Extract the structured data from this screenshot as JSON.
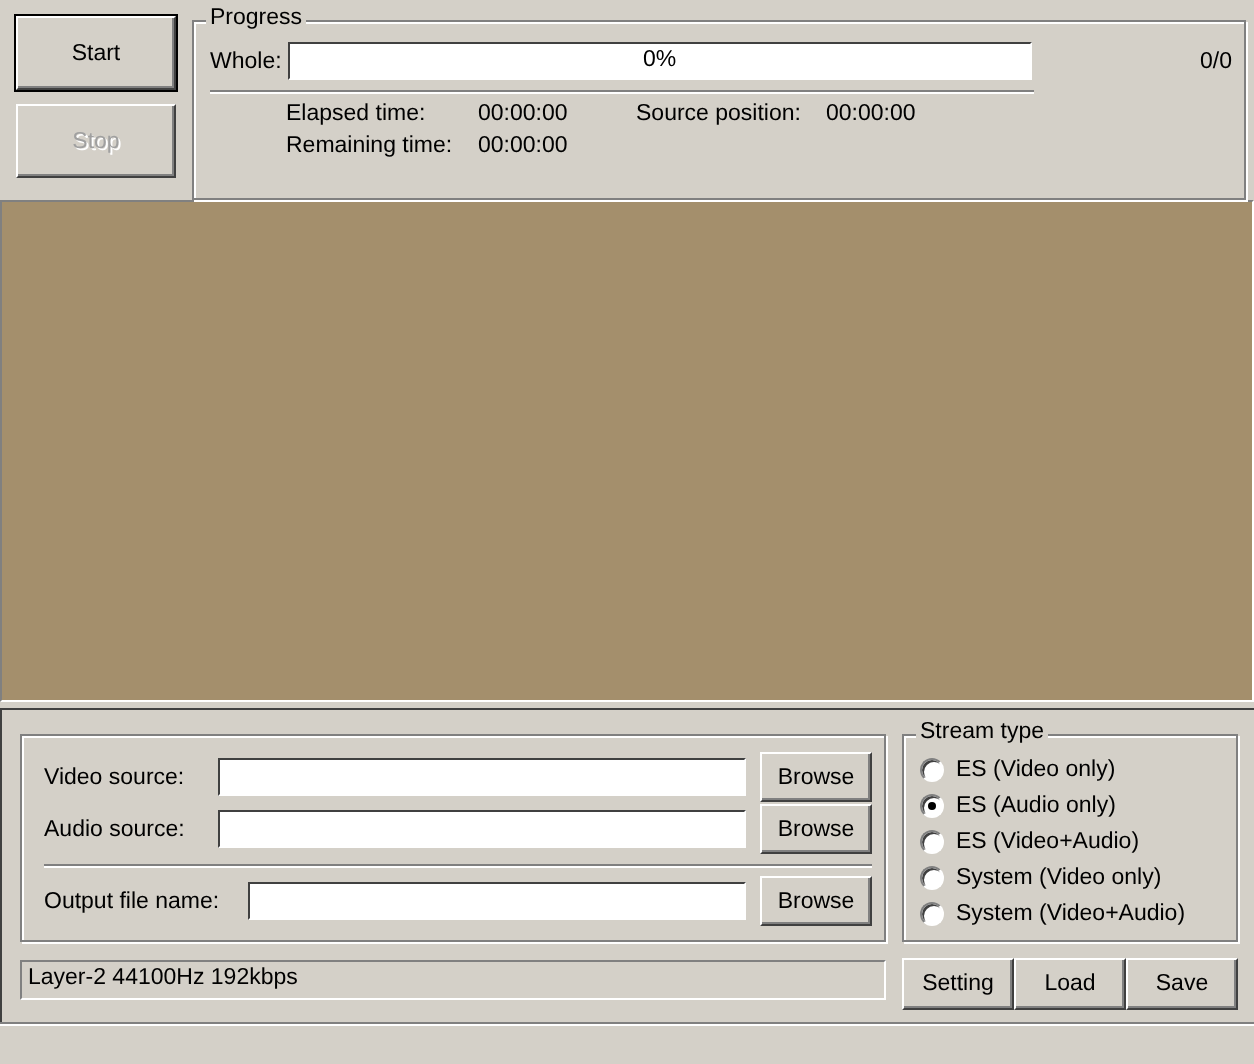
{
  "buttons": [
    {
      "label": "Start",
      "disabled": false
    },
    {
      "label": "Stop",
      "disabled": true
    }
  ],
  "progress": {
    "title": "Progress",
    "whole_label": "Whole:",
    "percent": "0%",
    "level": 0,
    "count": "0/0",
    "times": [
      {
        "label": "Elapsed time:",
        "value": "00:00:00"
      },
      {
        "label": "Remaining time:",
        "value": "00:00:00"
      },
      {
        "label": "Source position:",
        "value": "00:00:00"
      }
    ]
  },
  "sources": [
    {
      "label": "Video source:",
      "button": "Browse"
    },
    {
      "label": "Audio source:",
      "button": "Browse"
    },
    {
      "label": "Output file name:",
      "button": "Browse"
    }
  ],
  "stream_type": {
    "title": "Stream type",
    "options": [
      {
        "label": "ES (Video only)",
        "selected": false
      },
      {
        "label": "ES (Audio only)",
        "selected": true
      },
      {
        "label": "ES (Video+Audio)",
        "selected": false
      },
      {
        "label": "System (Video only)",
        "selected": false
      },
      {
        "label": "System (Video+Audio)",
        "selected": false
      }
    ]
  },
  "info": "Layer-2 44100Hz 192kbps",
  "actions": [
    "Setting",
    "Load",
    "Save"
  ]
}
